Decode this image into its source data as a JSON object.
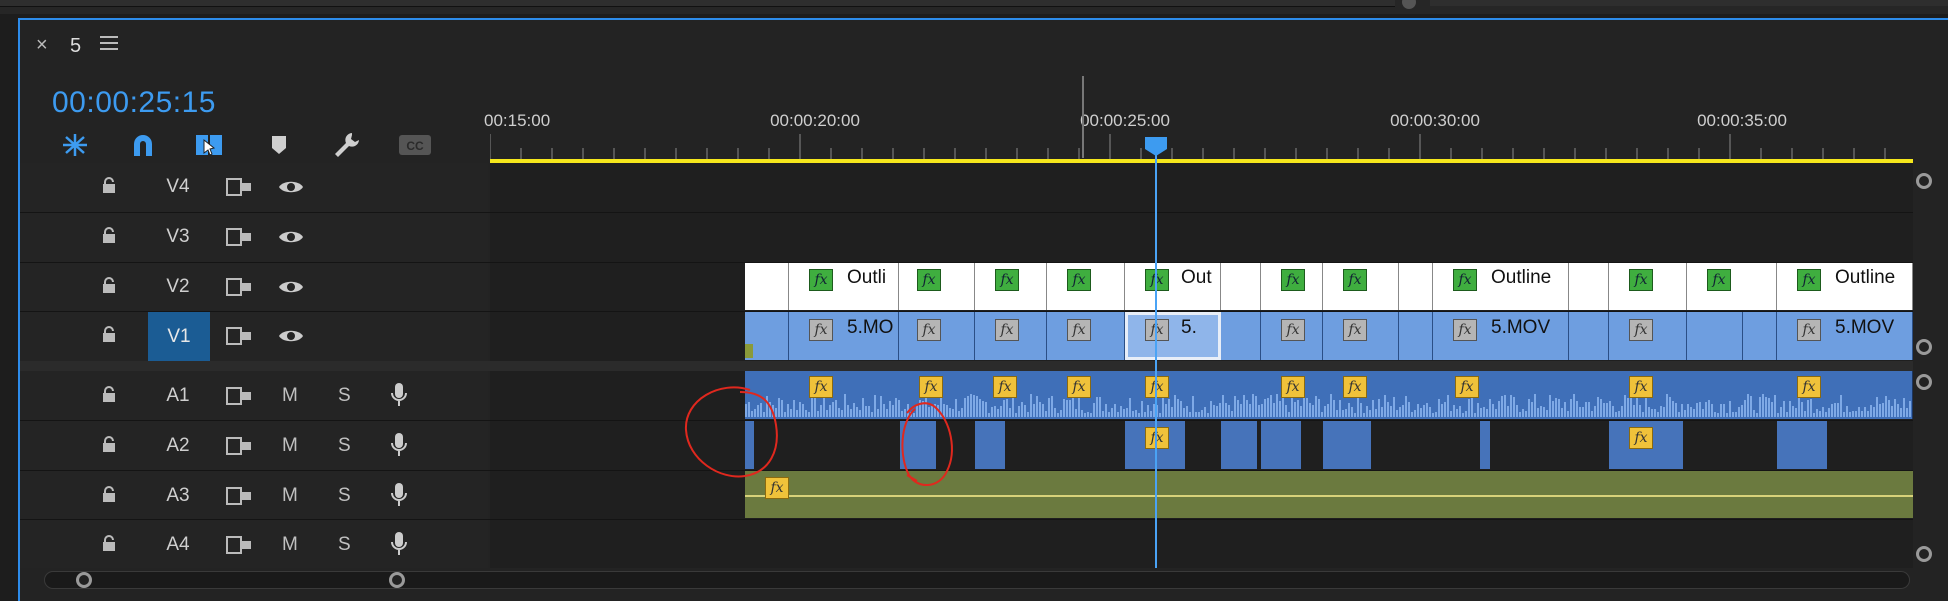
{
  "tab": {
    "close": "×",
    "name": "5"
  },
  "timecode": "00:00:25:15",
  "toolbar": [
    {
      "name": "nested-sequence-icon"
    },
    {
      "name": "snap-magnet-icon"
    },
    {
      "name": "linked-selection-icon"
    },
    {
      "name": "add-marker-icon"
    },
    {
      "name": "settings-wrench-icon"
    },
    {
      "name": "captions-icon"
    }
  ],
  "ruler": {
    "start_label": "00:15:00",
    "labels": [
      "00:00:20:00",
      "00:00:25:00",
      "00:00:30:00",
      "00:00:35:00"
    ]
  },
  "tracks": {
    "v4": "V4",
    "v3": "V3",
    "v2": "V2",
    "v1": "V1",
    "a1": "A1",
    "a2": "A2",
    "a3": "A3",
    "a4": "A4",
    "mute": "M",
    "solo": "S"
  },
  "clips": {
    "v2_fx": "fx",
    "v2_names": [
      "Outli",
      "Out",
      "Outline",
      "Outline"
    ],
    "v1_names": [
      "5.MO",
      "5.",
      "5.MOV",
      "5.MOV"
    ],
    "fx": "fx"
  },
  "colors": {
    "accent": "#2d8ceb",
    "timecode": "#3d9bf0",
    "work_area": "#f5e71c",
    "video_clip": "#6e9ee0",
    "audio_clip": "#3f6fb8",
    "adjustment_audio": "#6b7a3f",
    "annotation": "#e0281e"
  }
}
